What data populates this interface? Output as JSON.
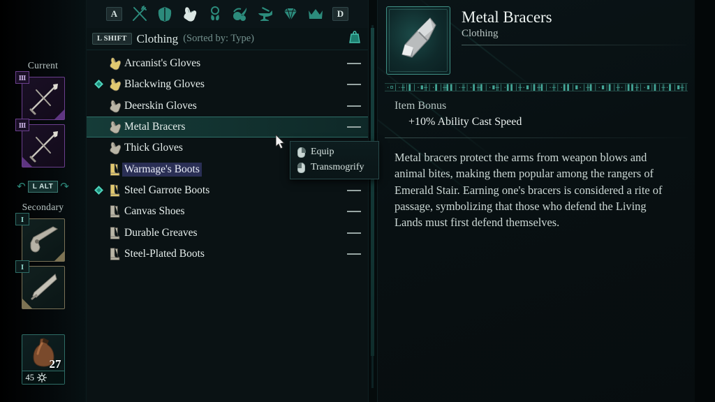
{
  "equipment_rail": {
    "current_label": "Current",
    "secondary_label": "Secondary",
    "swap_key": "L ALT",
    "primary_slots": [
      {
        "badge": "III",
        "icon": "crossed-blades-icon",
        "rarity_color": "#6b3f8e"
      },
      {
        "badge": "III",
        "icon": "crossed-blades-icon",
        "rarity_color": "#6b3f8e"
      }
    ],
    "secondary_slots": [
      {
        "badge": "I",
        "icon": "pistol-icon",
        "rarity_color": "#7a7257"
      },
      {
        "badge": "I",
        "icon": "dagger-icon",
        "rarity_color": "#7a7257"
      }
    ],
    "consumable": {
      "icon": "potion-flask-icon",
      "count": "27",
      "value": "45",
      "value_icon": "resource-sparkle-icon"
    }
  },
  "category_bar": {
    "prev_key": "A",
    "next_key": "D",
    "categories": [
      {
        "name": "weapons-category",
        "icon": "crossed-weapons-icon",
        "selected": false
      },
      {
        "name": "armor-category",
        "icon": "chest-armor-icon",
        "selected": false
      },
      {
        "name": "clothing-category",
        "icon": "gloves-icon",
        "selected": true
      },
      {
        "name": "jewelry-category",
        "icon": "amulet-icon",
        "selected": false
      },
      {
        "name": "consumables-category",
        "icon": "food-flask-icon",
        "selected": false
      },
      {
        "name": "crafting-category",
        "icon": "anvil-icon",
        "selected": false
      },
      {
        "name": "gems-category",
        "icon": "gem-icon",
        "selected": false
      },
      {
        "name": "cosmetics-category",
        "icon": "crown-icon",
        "selected": false
      }
    ]
  },
  "list_header": {
    "shift_key": "L SHIFT",
    "title": "Clothing",
    "sort": "(Sorted by: Type)",
    "weight_icon": "weight-scale-icon"
  },
  "items": [
    {
      "name": "Arcanist's Gloves",
      "icon": "gloves-icon",
      "icon_tint": "#e0c870",
      "equipped": false,
      "selected": false,
      "hovered": false,
      "weight": "—"
    },
    {
      "name": "Blackwing Gloves",
      "icon": "gloves-icon",
      "icon_tint": "#e0c870",
      "equipped": true,
      "selected": false,
      "hovered": false,
      "weight": "—"
    },
    {
      "name": "Deerskin Gloves",
      "icon": "gloves-icon",
      "icon_tint": "#b9b5a6",
      "equipped": false,
      "selected": false,
      "hovered": false,
      "weight": "—"
    },
    {
      "name": "Metal Bracers",
      "icon": "gloves-icon",
      "icon_tint": "#b9b5a6",
      "equipped": false,
      "selected": true,
      "hovered": false,
      "weight": "—"
    },
    {
      "name": "Thick Gloves",
      "icon": "gloves-icon",
      "icon_tint": "#b9b5a6",
      "equipped": false,
      "selected": false,
      "hovered": false,
      "weight": "—"
    },
    {
      "name": "Warmage's Boots",
      "icon": "boots-icon",
      "icon_tint": "#e0c870",
      "equipped": false,
      "selected": false,
      "hovered": true,
      "weight": "—"
    },
    {
      "name": "Steel Garrote Boots",
      "icon": "boots-icon",
      "icon_tint": "#e0c870",
      "equipped": true,
      "selected": false,
      "hovered": false,
      "weight": "—"
    },
    {
      "name": "Canvas Shoes",
      "icon": "boots-icon",
      "icon_tint": "#b9b5a6",
      "equipped": false,
      "selected": false,
      "hovered": false,
      "weight": "—"
    },
    {
      "name": "Durable Greaves",
      "icon": "boots-icon",
      "icon_tint": "#b9b5a6",
      "equipped": false,
      "selected": false,
      "hovered": false,
      "weight": "—"
    },
    {
      "name": "Steel-Plated Boots",
      "icon": "boots-icon",
      "icon_tint": "#b9b5a6",
      "equipped": false,
      "selected": false,
      "hovered": false,
      "weight": "—"
    }
  ],
  "context_menu": {
    "items": [
      {
        "label": "Equip",
        "mouse": "left-mouse-button-icon"
      },
      {
        "label": "Transmogrify",
        "mouse": "right-mouse-button-icon"
      }
    ]
  },
  "detail": {
    "title": "Metal Bracers",
    "type": "Clothing",
    "thumb_icon": "metal-bracer-item-icon",
    "bonus_label": "Item Bonus",
    "bonus_value": "+10% Ability Cast Speed",
    "description": "Metal bracers protect the arms from weapon blows and animal bites, making them popular among the rangers of Emerald Stair. Earning one's bracers is considered a rite of passage, symbolizing that those who defend the Living Lands must first defend themselves.",
    "rune_glyphs": "·¤│·╫│▌│·∎╫│·▌│╫▌▌│·╫│·▌╫▌│·∎╫│·▌▌│╫·∎│▌╫▌│·╫│·▌▌│∎·│╫▌│·∎│▌│╫·│▌▌╫│·∎│▌│╫·▌│∎╫│▌·│╫▌│·∎▌│╫·│▌∎│╫▌│·│▌╫│∎·│▌│╫▌│·∎│╫▌│·│▌∎│╫·│▌╫│"
  },
  "colors": {
    "accent_teal": "#3f8f84",
    "bright_teal": "#4fd3bb",
    "panel_bg": "#0a1214",
    "rarity_purple": "#6b3f8e",
    "rarity_gold": "#e0c870",
    "hover_blue": "#2a2f55"
  }
}
